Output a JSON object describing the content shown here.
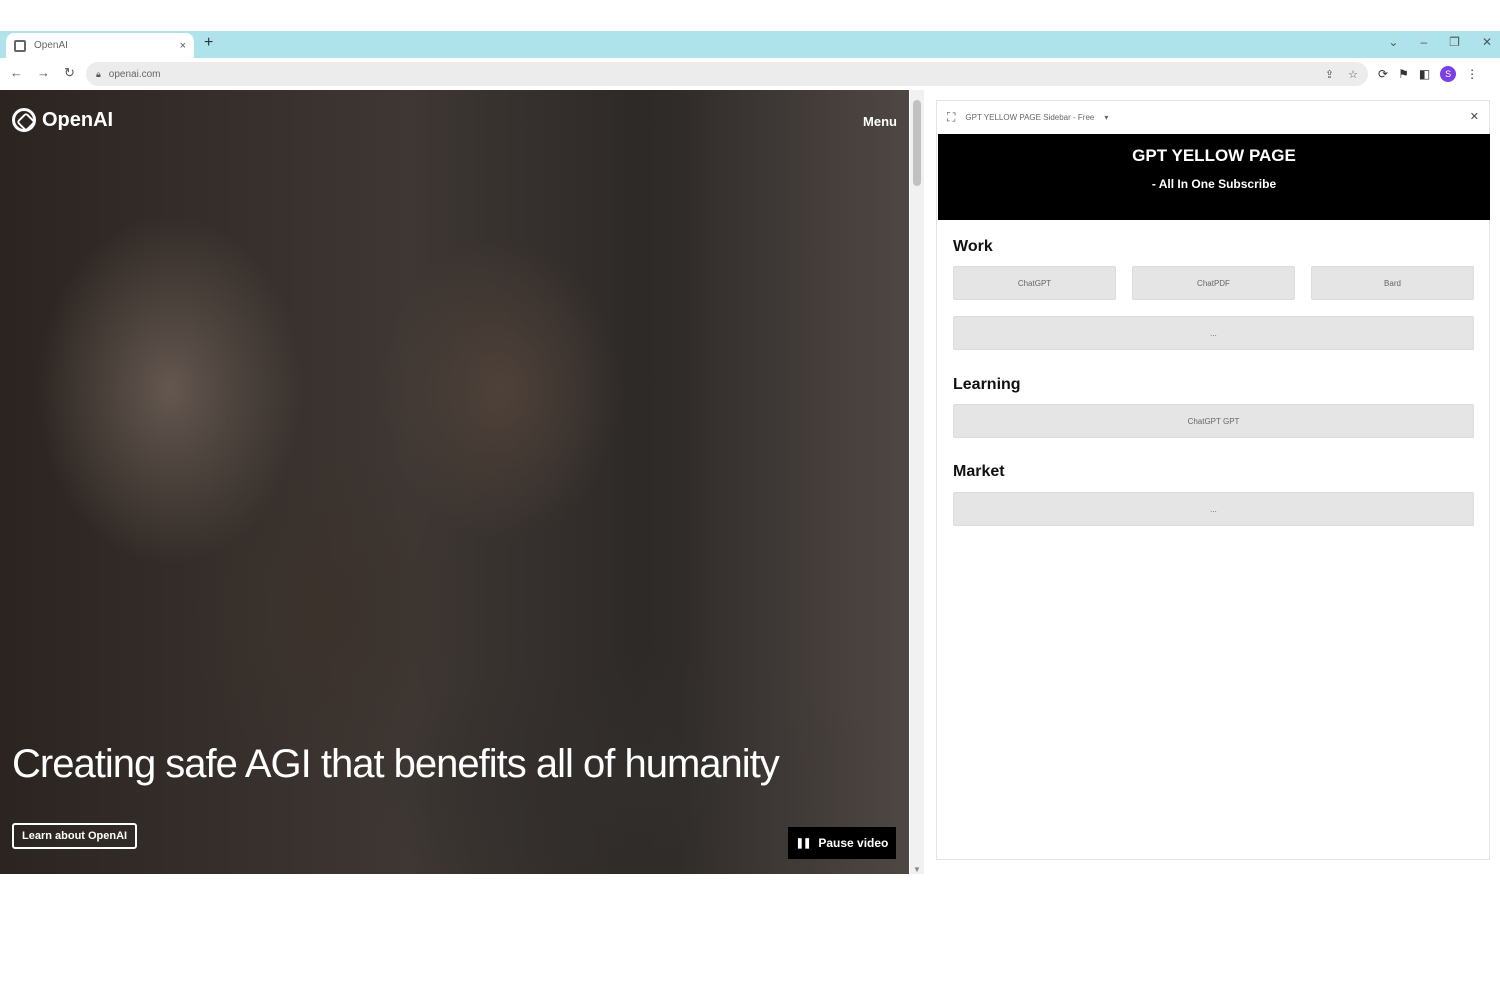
{
  "browser": {
    "tab_title": "OpenAI",
    "tab_close": "×",
    "new_tab": "+",
    "window_controls": [
      "⌄",
      "–",
      "❐",
      "✕"
    ],
    "nav": [
      "←",
      "→",
      "↻"
    ],
    "url": "openai.com",
    "omnibox_actions": [
      "⇪",
      "☆"
    ],
    "ext_icons": [
      "⟳",
      "⚑",
      "◧",
      "⋮"
    ],
    "avatar_letter": "S"
  },
  "page": {
    "logo_text": "OpenAI",
    "menu_label": "Menu",
    "headline": "Creating safe AGI that benefits all of humanity",
    "learn_button": "Learn about OpenAI",
    "pause_icon": "❚❚",
    "pause_label": "Pause video"
  },
  "sidepanel": {
    "header_title": "GPT YELLOW PAGE Sidebar - Free",
    "header_caret": "▾",
    "close": "✕",
    "banner_title": "GPT YELLOW PAGE",
    "banner_subtitle": "- All In One Subscribe",
    "sections": [
      {
        "title": "Work",
        "items": [
          "ChatGPT",
          "ChatPDF",
          "Bard",
          "..."
        ]
      },
      {
        "title": "Learning",
        "items": [
          "ChatGPT GPT"
        ]
      },
      {
        "title": "Market",
        "items": [
          "..."
        ]
      }
    ]
  }
}
